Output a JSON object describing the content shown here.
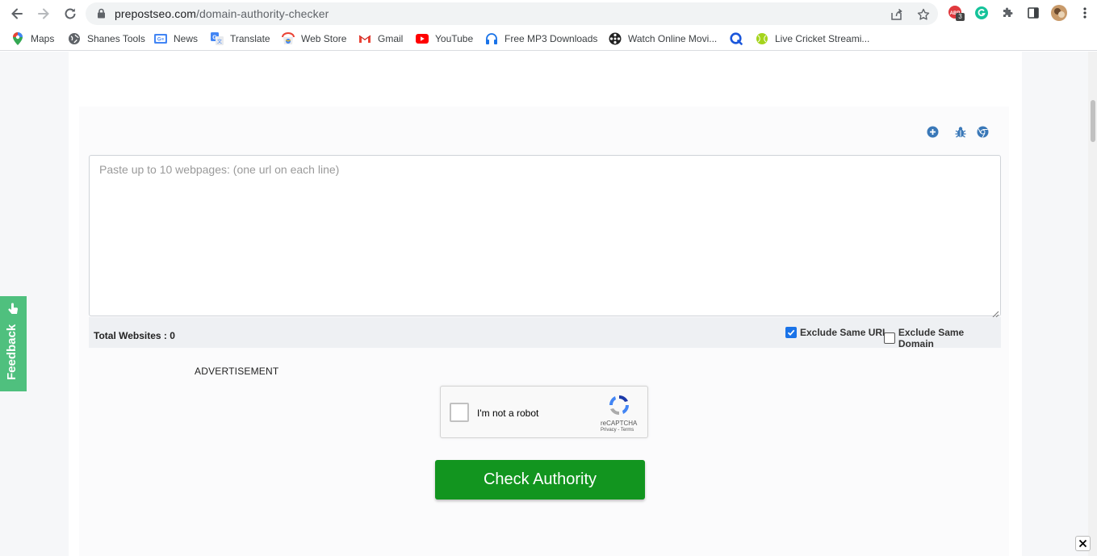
{
  "browser": {
    "url_domain": "prepostseo.com",
    "url_path": "/domain-authority-checker",
    "extension_badge": "3",
    "bookmarks": [
      {
        "label": "Maps",
        "icon": "maps-pin-icon"
      },
      {
        "label": "Shanes Tools",
        "icon": "globe-icon"
      },
      {
        "label": "News",
        "icon": "google-news-icon"
      },
      {
        "label": "Translate",
        "icon": "translate-icon"
      },
      {
        "label": "Web Store",
        "icon": "web-store-icon"
      },
      {
        "label": "Gmail",
        "icon": "gmail-icon"
      },
      {
        "label": "YouTube",
        "icon": "youtube-icon"
      },
      {
        "label": "Free MP3 Downloads",
        "icon": "headphones-icon"
      },
      {
        "label": "Watch Online Movi...",
        "icon": "film-reel-icon"
      },
      {
        "label": "",
        "icon": "q-app-icon"
      },
      {
        "label": "Live Cricket Streami...",
        "icon": "cricket-ball-icon"
      }
    ]
  },
  "tool": {
    "textarea_placeholder": "Paste up to 10 webpages: (one url on each line)",
    "total_label": "Total Websites : 0",
    "exclude_same_url": {
      "label": "Exclude Same URL",
      "checked": true
    },
    "exclude_same_domain": {
      "label": "Exclude Same Domain",
      "checked": false
    },
    "advertisement_label": "ADVERTISEMENT",
    "captcha": {
      "label": "I'm not a robot",
      "brand": "reCAPTCHA",
      "links": "Privacy - Terms"
    },
    "submit_label": "Check Authority"
  },
  "feedback": {
    "label": "Feedback"
  },
  "colors": {
    "button_green": "#12951f",
    "feedback_green": "#4fc07e",
    "checkbox_blue": "#1a73e8"
  }
}
